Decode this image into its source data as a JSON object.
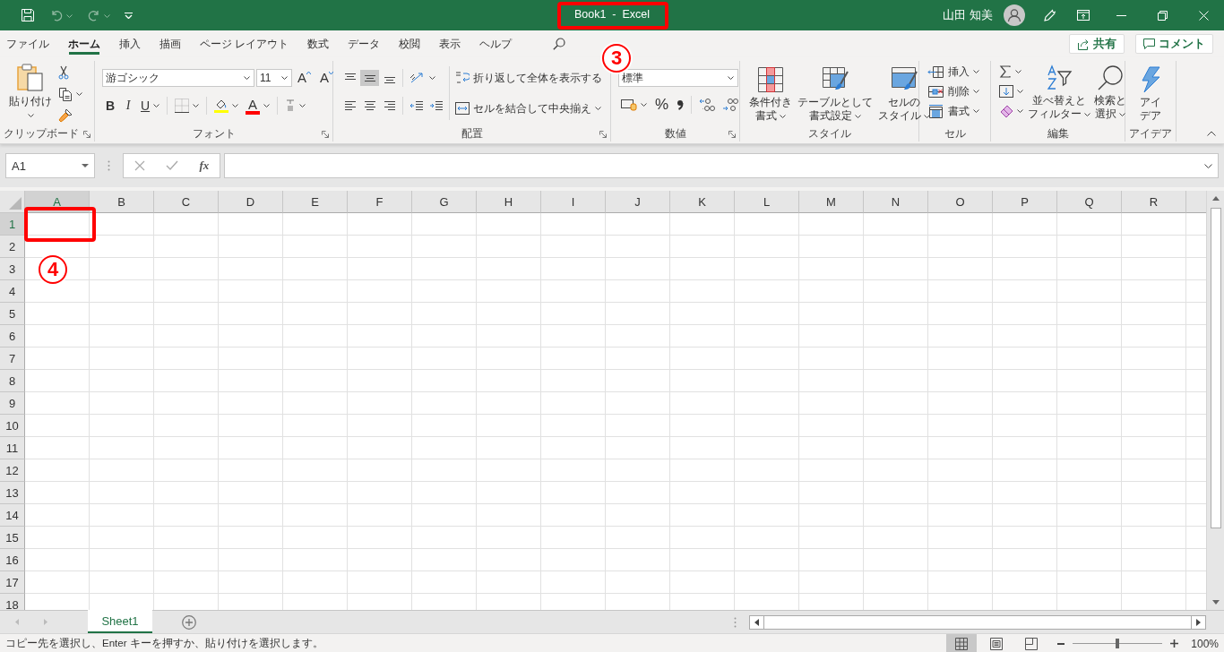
{
  "title_bar": {
    "title": "Book1  -  Excel",
    "user_name": "山田 知美"
  },
  "menu_tabs": [
    {
      "label": "ファイル",
      "selected": false
    },
    {
      "label": "ホーム",
      "selected": true
    },
    {
      "label": "挿入",
      "selected": false
    },
    {
      "label": "描画",
      "selected": false
    },
    {
      "label": "ページ レイアウト",
      "selected": false
    },
    {
      "label": "数式",
      "selected": false
    },
    {
      "label": "データ",
      "selected": false
    },
    {
      "label": "校閲",
      "selected": false
    },
    {
      "label": "表示",
      "selected": false
    },
    {
      "label": "ヘルプ",
      "selected": false
    }
  ],
  "share_button": {
    "label": "共有"
  },
  "comment_button": {
    "label": "コメント"
  },
  "ribbon": {
    "clipboard": {
      "label": "クリップボード",
      "paste": "貼り付け"
    },
    "font": {
      "label": "フォント",
      "font_name": "游ゴシック",
      "font_size": "11",
      "grow": "A",
      "shrink": "A",
      "bold": "B",
      "italic": "I",
      "underline": "U",
      "font_color": "A"
    },
    "alignment": {
      "label": "配置",
      "vertical_align": [
        {
          "kind": "top",
          "selected": false
        },
        {
          "kind": "middle",
          "selected": true
        },
        {
          "kind": "bottom",
          "selected": false
        }
      ],
      "wrap_text": "折り返して全体を表示する",
      "merge": "セルを結合して中央揃え"
    },
    "number": {
      "label": "数値",
      "format": "標準",
      "percent": "%"
    },
    "styles": {
      "label": "スタイル",
      "buttons": [
        {
          "kind": "conditional",
          "lines": [
            "条件付き",
            "書式"
          ]
        },
        {
          "kind": "table",
          "lines": [
            "テーブルとして",
            "書式設定"
          ]
        },
        {
          "kind": "cell_style",
          "lines": [
            "セルの",
            "スタイル"
          ]
        }
      ]
    },
    "cells": {
      "label": "セル",
      "buttons": [
        {
          "kind": "insert",
          "label": "挿入"
        },
        {
          "kind": "delete",
          "label": "削除"
        },
        {
          "kind": "format",
          "label": "書式"
        }
      ]
    },
    "editing": {
      "label": "編集",
      "buttons": [
        {
          "kind": "sort",
          "lines": [
            "並べ替えと",
            "フィルター"
          ]
        },
        {
          "kind": "find",
          "lines": [
            "検索と",
            "選択"
          ]
        }
      ]
    },
    "ideas": {
      "label": "アイデア",
      "lines": [
        "アイ",
        "デア"
      ]
    }
  },
  "formula_bar": {
    "name_box": "A1",
    "function_label": "fx"
  },
  "sheet": {
    "columns": [
      {
        "label": "A",
        "selected": true
      },
      {
        "label": "B",
        "selected": false
      },
      {
        "label": "C",
        "selected": false
      },
      {
        "label": "D",
        "selected": false
      },
      {
        "label": "E",
        "selected": false
      },
      {
        "label": "F",
        "selected": false
      },
      {
        "label": "G",
        "selected": false
      },
      {
        "label": "H",
        "selected": false
      },
      {
        "label": "I",
        "selected": false
      },
      {
        "label": "J",
        "selected": false
      },
      {
        "label": "K",
        "selected": false
      },
      {
        "label": "L",
        "selected": false
      },
      {
        "label": "M",
        "selected": false
      },
      {
        "label": "N",
        "selected": false
      },
      {
        "label": "O",
        "selected": false
      },
      {
        "label": "P",
        "selected": false
      },
      {
        "label": "Q",
        "selected": false
      },
      {
        "label": "R",
        "selected": false
      }
    ],
    "rows": [
      {
        "label": "1",
        "selected": true
      },
      {
        "label": "2",
        "selected": false
      },
      {
        "label": "3",
        "selected": false
      },
      {
        "label": "4",
        "selected": false
      },
      {
        "label": "5",
        "selected": false
      },
      {
        "label": "6",
        "selected": false
      },
      {
        "label": "7",
        "selected": false
      },
      {
        "label": "8",
        "selected": false
      },
      {
        "label": "9",
        "selected": false
      },
      {
        "label": "10",
        "selected": false
      },
      {
        "label": "11",
        "selected": false
      },
      {
        "label": "12",
        "selected": false
      },
      {
        "label": "13",
        "selected": false
      },
      {
        "label": "14",
        "selected": false
      },
      {
        "label": "15",
        "selected": false
      },
      {
        "label": "16",
        "selected": false
      },
      {
        "label": "17",
        "selected": false
      },
      {
        "label": "18",
        "selected": false
      }
    ]
  },
  "sheet_tabs": [
    {
      "label": "Sheet1",
      "selected": true
    }
  ],
  "status_bar": {
    "message": "コピー先を選択し、Enter キーを押すか、貼り付けを選択します。",
    "views": [
      {
        "kind": "normal",
        "selected": true
      },
      {
        "kind": "page_layout",
        "selected": false
      },
      {
        "kind": "page_break",
        "selected": false
      }
    ],
    "zoom_slider": {
      "level": 0.5
    },
    "zoom": "100%"
  },
  "annotations": [
    {
      "kind": "title_box"
    },
    {
      "kind": "ribbon_number",
      "label": "3"
    },
    {
      "kind": "cell_box"
    },
    {
      "kind": "cell_number",
      "label": "4"
    }
  ]
}
